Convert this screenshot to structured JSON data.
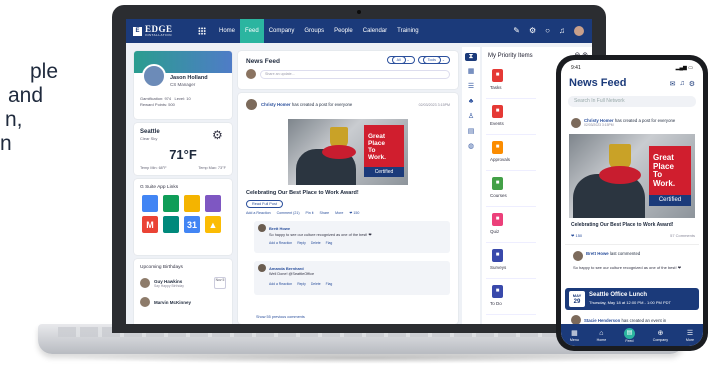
{
  "side_text": [
    "ple",
    "and",
    "n,",
    "n"
  ],
  "topbar": {
    "logo_main": "EDGE",
    "logo_sub": "INSTALLATION",
    "nav": [
      "Home",
      "Feed",
      "Company",
      "Groups",
      "People",
      "Calendar",
      "Training"
    ],
    "active_nav": "Feed"
  },
  "profile": {
    "name": "Jason Holland",
    "role": "CS Manager",
    "gamification": "Gamification: 974",
    "level": "Level: 10",
    "reward_points": "Reward Points: 500"
  },
  "weather": {
    "city": "Seattle",
    "condition": "Clear Sky",
    "temp": "71°F",
    "min": "Temp Min: 68°F",
    "max": "Temp Max: 73°F"
  },
  "gsuite": {
    "title": "G Suite App Links",
    "apps": [
      {
        "icon": "docs-icon",
        "letter": "",
        "color": "#4285f4"
      },
      {
        "icon": "sheets-icon",
        "letter": "",
        "color": "#0f9d58"
      },
      {
        "icon": "slides-icon",
        "letter": "",
        "color": "#f4b400"
      },
      {
        "icon": "forms-icon",
        "letter": "",
        "color": "#7e57c2"
      },
      {
        "icon": "gmail-icon",
        "letter": "M",
        "color": "#ea4335"
      },
      {
        "icon": "meet-icon",
        "letter": "",
        "color": "#00897b"
      },
      {
        "icon": "calendar-icon",
        "letter": "31",
        "color": "#4285f4"
      },
      {
        "icon": "drive-icon",
        "letter": "▲",
        "color": "#fbbc04"
      }
    ]
  },
  "birthdays": {
    "title": "Upcoming Birthdays",
    "people": [
      {
        "name": "Guy Hawkins",
        "sub": "Say Happy Birthday",
        "date": "Nov 5"
      },
      {
        "name": "Marvin McKinney",
        "sub": "",
        "date": ""
      }
    ]
  },
  "feed": {
    "title": "News Feed",
    "filter_all": "All",
    "filter_tools": "Tools",
    "share_placeholder": "Share an update..."
  },
  "post": {
    "author": "Christy Homer",
    "action": "has created a post for everyone",
    "date": "02/03/2023 3:15PM",
    "badge_lines": [
      "Great",
      "Place",
      "To",
      "Work."
    ],
    "badge_cert": "Certified",
    "title": "Celebrating Our Best Place to Work Award!",
    "read_btn": "Read Full Post",
    "actions": [
      "Add a Reaction",
      "Comment (21)",
      "Pin it",
      "Share",
      "More"
    ],
    "reaction_count": "150",
    "comments": [
      {
        "author": "Brett Howe",
        "text": "So happy to see our culture recognized as one of the best! ❤",
        "acts": [
          "Add a Reaction",
          "Reply",
          "Delete",
          "Flag"
        ]
      },
      {
        "author": "Amanda Bernhard",
        "text": "Well Done! @SeattleOffice",
        "acts": [
          "Add a Reaction",
          "Reply",
          "Delete",
          "Flag"
        ]
      }
    ],
    "show_more": "Show 55 previous comments"
  },
  "priority": {
    "title": "My Priority Items",
    "items": [
      {
        "label": "Tasks",
        "color": "#e53935",
        "icon": "tasks-icon"
      },
      {
        "label": "Events",
        "color": "#e53935",
        "icon": "events-icon"
      },
      {
        "label": "Approvals",
        "color": "#fb8c00",
        "icon": "approvals-icon"
      },
      {
        "label": "Courses",
        "color": "#43a047",
        "icon": "courses-icon"
      },
      {
        "label": "Quiz",
        "color": "#ec407a",
        "icon": "quiz-icon"
      },
      {
        "label": "Surveys",
        "color": "#3949ab",
        "icon": "surveys-icon"
      },
      {
        "label": "To Do",
        "color": "#3949ab",
        "icon": "todo-icon"
      }
    ]
  },
  "phone": {
    "time": "9:41",
    "title": "News Feed",
    "search": "Search In Full Network",
    "post_author": "Christy Homer",
    "post_action": "has created a post for everyone",
    "post_date": "02/03/2023 3:15PM",
    "post_title": "Celebrating Our Best Place to Work Award!",
    "reaction_count": "150",
    "comments_count": "57 Comments",
    "comment_author": "Brett Howe",
    "comment_action": "last commented",
    "comment_text": "So happy to see our culture recognized as one of the best! ❤",
    "event_month": "MAY",
    "event_day": "29",
    "event_title": "Seattle Office Lunch",
    "event_time": "Thursday, May 18 at 12:00 PM - 1:00 PM PDT",
    "next_author": "Stacie Henderson",
    "next_action": "has created an event in",
    "nav": [
      "Menu",
      "Home",
      "Feed",
      "Company",
      "More"
    ]
  }
}
